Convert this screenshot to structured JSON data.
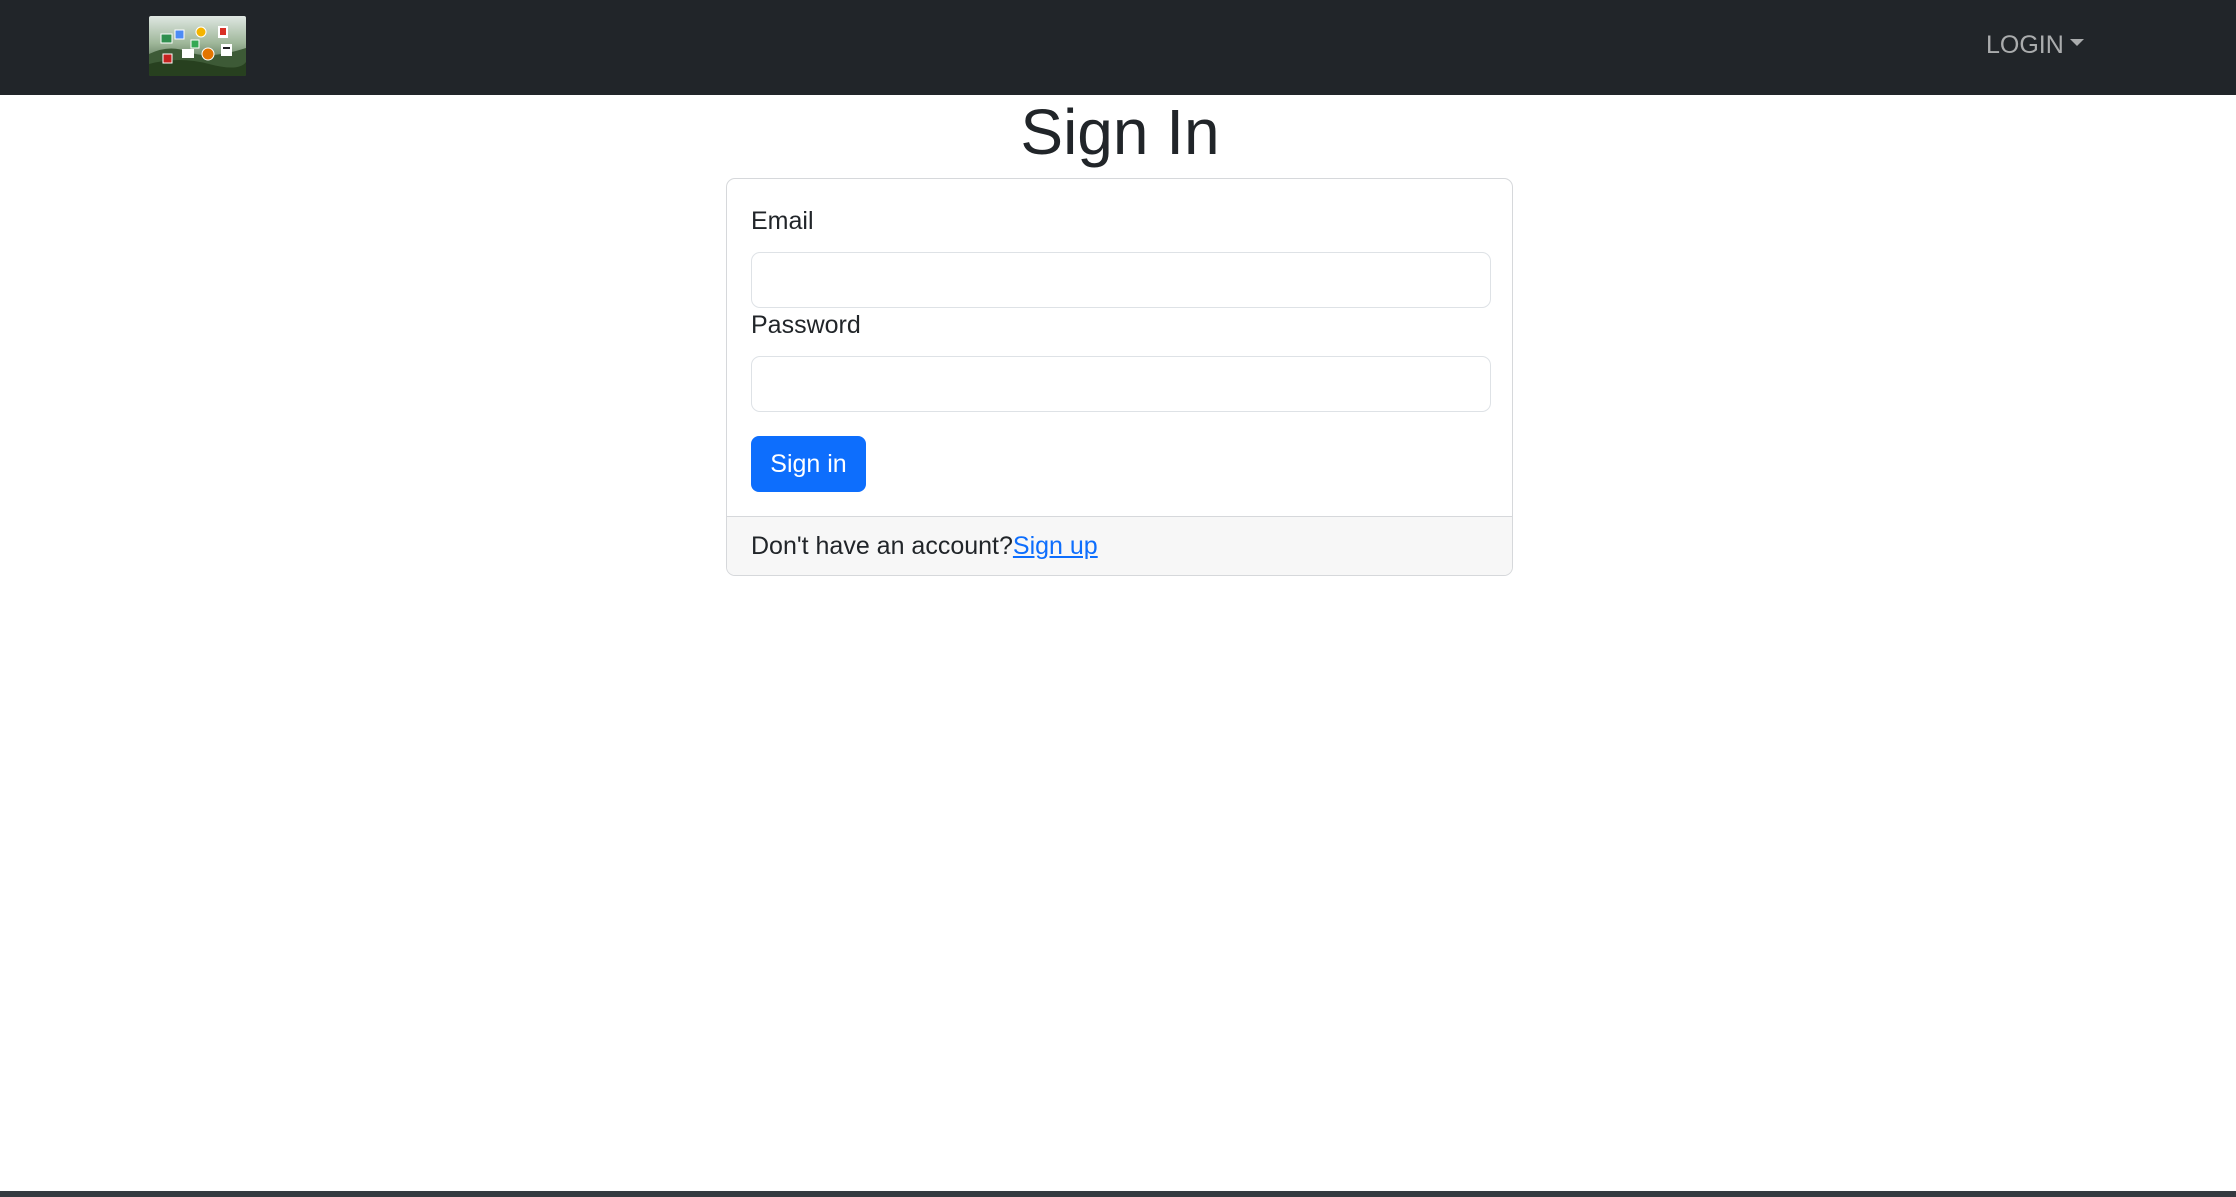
{
  "navbar": {
    "login_label": "LOGIN",
    "background": "#212529",
    "logo_icon": "app-icons-collage-logo"
  },
  "page": {
    "title": "Sign In"
  },
  "form": {
    "email_label": "Email",
    "email_value": "",
    "password_label": "Password",
    "password_value": "",
    "submit_label": "Sign in",
    "submit_color": "#0d6efd"
  },
  "footer": {
    "prompt_text": "Don't have an account?",
    "signup_link": "Sign up"
  }
}
